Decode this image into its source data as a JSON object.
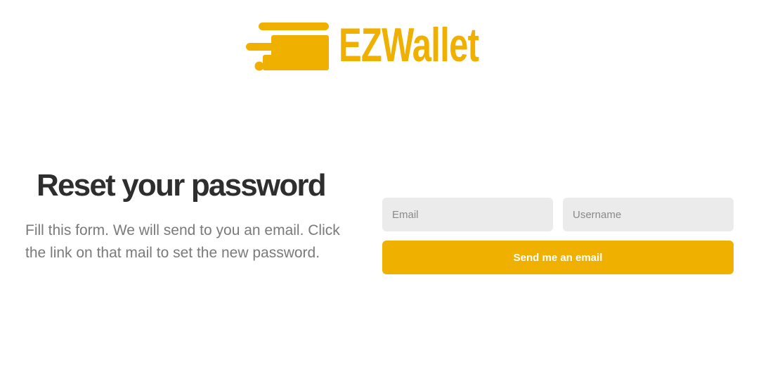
{
  "brand": {
    "name": "EZWallet",
    "logo_icon": "wallet-card-icon",
    "color": "#F0B000"
  },
  "reset": {
    "title": "Reset your password",
    "description": "Fill this form. We will send to you an email. Click the link on that mail to set the new password."
  },
  "form": {
    "email": {
      "placeholder": "Email",
      "value": ""
    },
    "username": {
      "placeholder": "Username",
      "value": ""
    },
    "submit_label": "Send me an email"
  },
  "colors": {
    "accent": "#F0B000",
    "heading": "#2E2E2E",
    "body_text": "#7A7A7A",
    "input_bg": "#EBEBEB"
  }
}
